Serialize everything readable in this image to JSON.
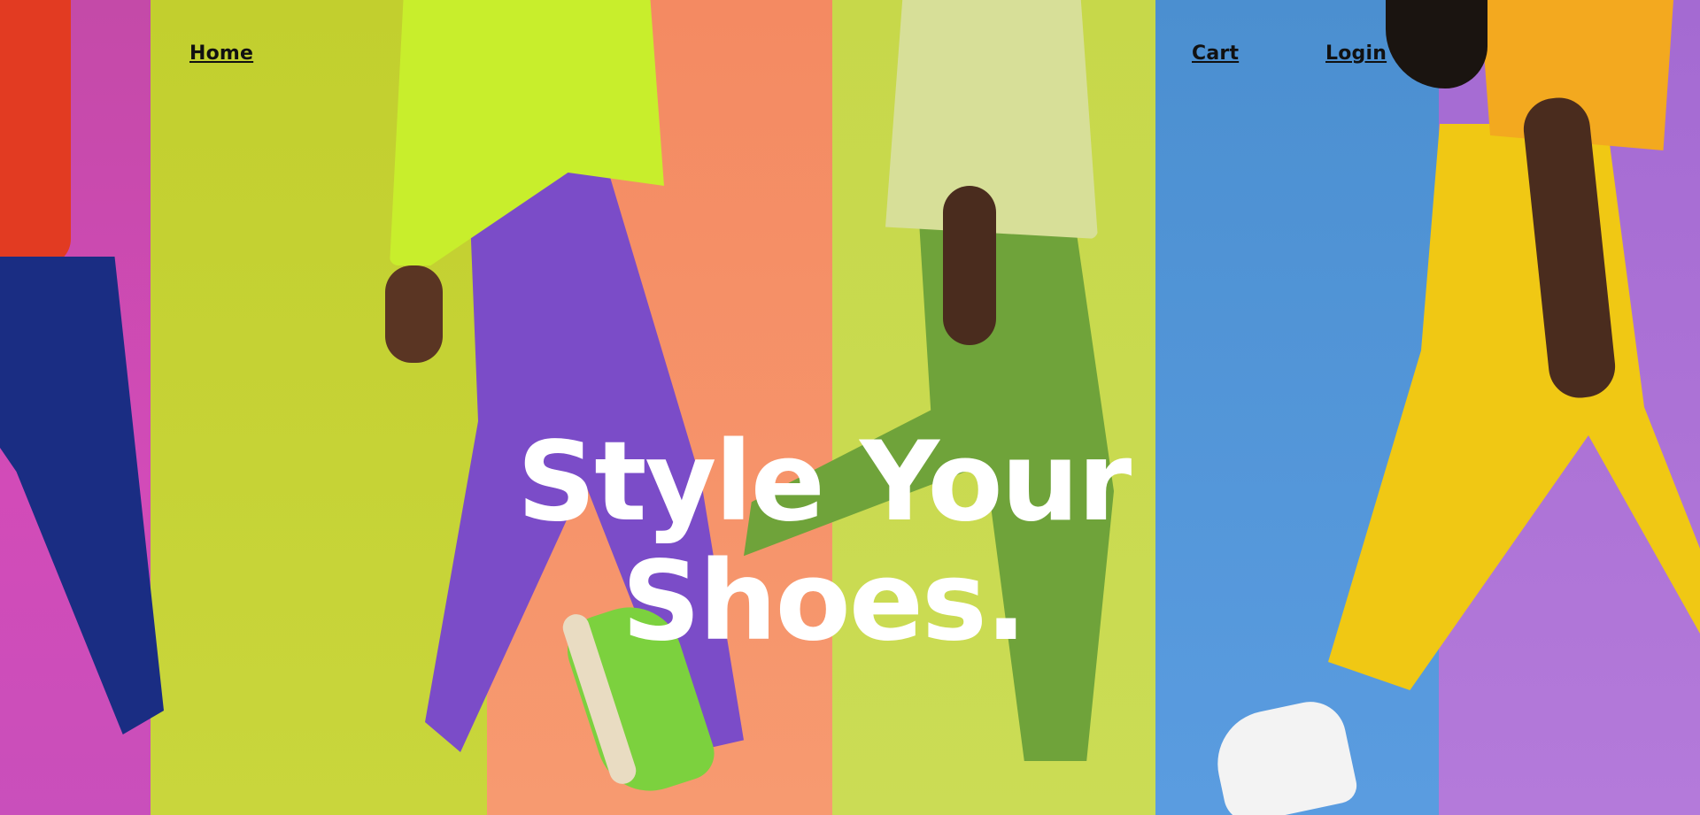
{
  "nav": {
    "home_label": "Home",
    "cart_label": "Cart",
    "login_label": "Login"
  },
  "hero": {
    "headline_line1": "Style Your",
    "headline_line2": "Shoes."
  },
  "colors": {
    "band_magenta": "#d24bb8",
    "band_lime": "#c9d63c",
    "band_coral": "#f79a70",
    "band_yellowgreen": "#cbdc55",
    "band_blue": "#5a9ce0",
    "band_violet": "#b47ada",
    "headline_text": "#ffffff",
    "nav_text": "#111111"
  }
}
